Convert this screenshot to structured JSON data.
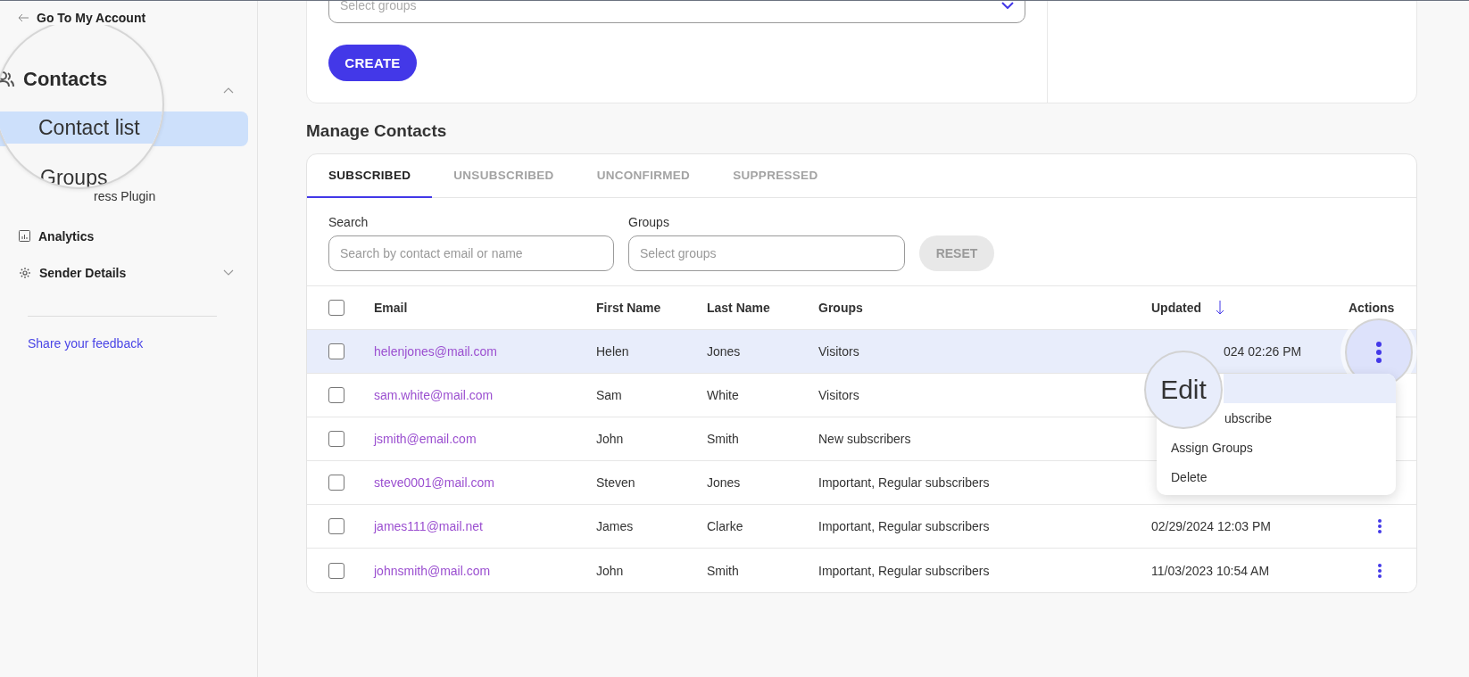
{
  "sidebar": {
    "back_link": "Go To My Account",
    "magnified_items": [
      {
        "label": "Contacts",
        "kind": "section",
        "expanded": true
      },
      {
        "label": "Contact list",
        "kind": "item",
        "selected": true
      },
      {
        "label": "Groups",
        "kind": "item",
        "selected": false
      }
    ],
    "partial_item": "ress Plugin",
    "items": [
      {
        "label": "Analytics"
      },
      {
        "label": "Sender Details",
        "expanded": false
      }
    ],
    "feedback": "Share your feedback"
  },
  "create_form": {
    "groups_placeholder": "Select groups",
    "button": "CREATE"
  },
  "section_title": "Manage Contacts",
  "tabs": [
    {
      "label": "SUBSCRIBED",
      "selected": true
    },
    {
      "label": "UNSUBSCRIBED",
      "selected": false
    },
    {
      "label": "UNCONFIRMED",
      "selected": false
    },
    {
      "label": "SUPPRESSED",
      "selected": false
    }
  ],
  "filters": {
    "search_label": "Search",
    "search_placeholder": "Search by contact email or name",
    "groups_label": "Groups",
    "groups_placeholder": "Select groups",
    "reset": "RESET"
  },
  "table": {
    "columns": [
      "Email",
      "First Name",
      "Last Name",
      "Groups",
      "Updated",
      "Actions"
    ],
    "header_checked": false,
    "rows": [
      {
        "email": "helenjones@mail.com",
        "first": "Helen",
        "last": "Jones",
        "groups": "Visitors",
        "updated": "024 02:26 PM",
        "updated_start_hidden": true,
        "selected": true,
        "checked": false,
        "kind": "magnified"
      },
      {
        "email": "sam.white@mail.com",
        "first": "Sam",
        "last": "White",
        "groups": "Visitors",
        "selected": false,
        "checked": false,
        "kind": "covered"
      },
      {
        "email": "jsmith@email.com",
        "first": "John",
        "last": "Smith",
        "groups": "New subscribers",
        "selected": false,
        "checked": false,
        "kind": "covered"
      },
      {
        "email": "steve0001@mail.com",
        "first": "Steven",
        "last": "Jones",
        "groups": "Important, Regular subscribers",
        "selected": false,
        "checked": false,
        "kind": "covered"
      },
      {
        "email": "james111@mail.net",
        "first": "James",
        "last": "Clarke",
        "groups": "Important, Regular subscribers",
        "updated": "02/29/2024 12:03 PM",
        "selected": false,
        "checked": false,
        "kind": "plain"
      },
      {
        "email": "johnsmith@mail.com",
        "first": "John",
        "last": "Smith",
        "groups": "Important, Regular subscribers",
        "updated": "11/03/2023 10:54 AM",
        "selected": false,
        "checked": false,
        "kind": "plain"
      }
    ]
  },
  "row_menu": {
    "items": [
      {
        "label": "Edit",
        "selected": true,
        "kind": "magnified"
      },
      {
        "label": "ubscribe",
        "selected": false,
        "kind": "partial"
      },
      {
        "label": "Assign Groups",
        "selected": false,
        "kind": "plain"
      },
      {
        "label": "Delete",
        "selected": false,
        "kind": "plain"
      }
    ]
  }
}
